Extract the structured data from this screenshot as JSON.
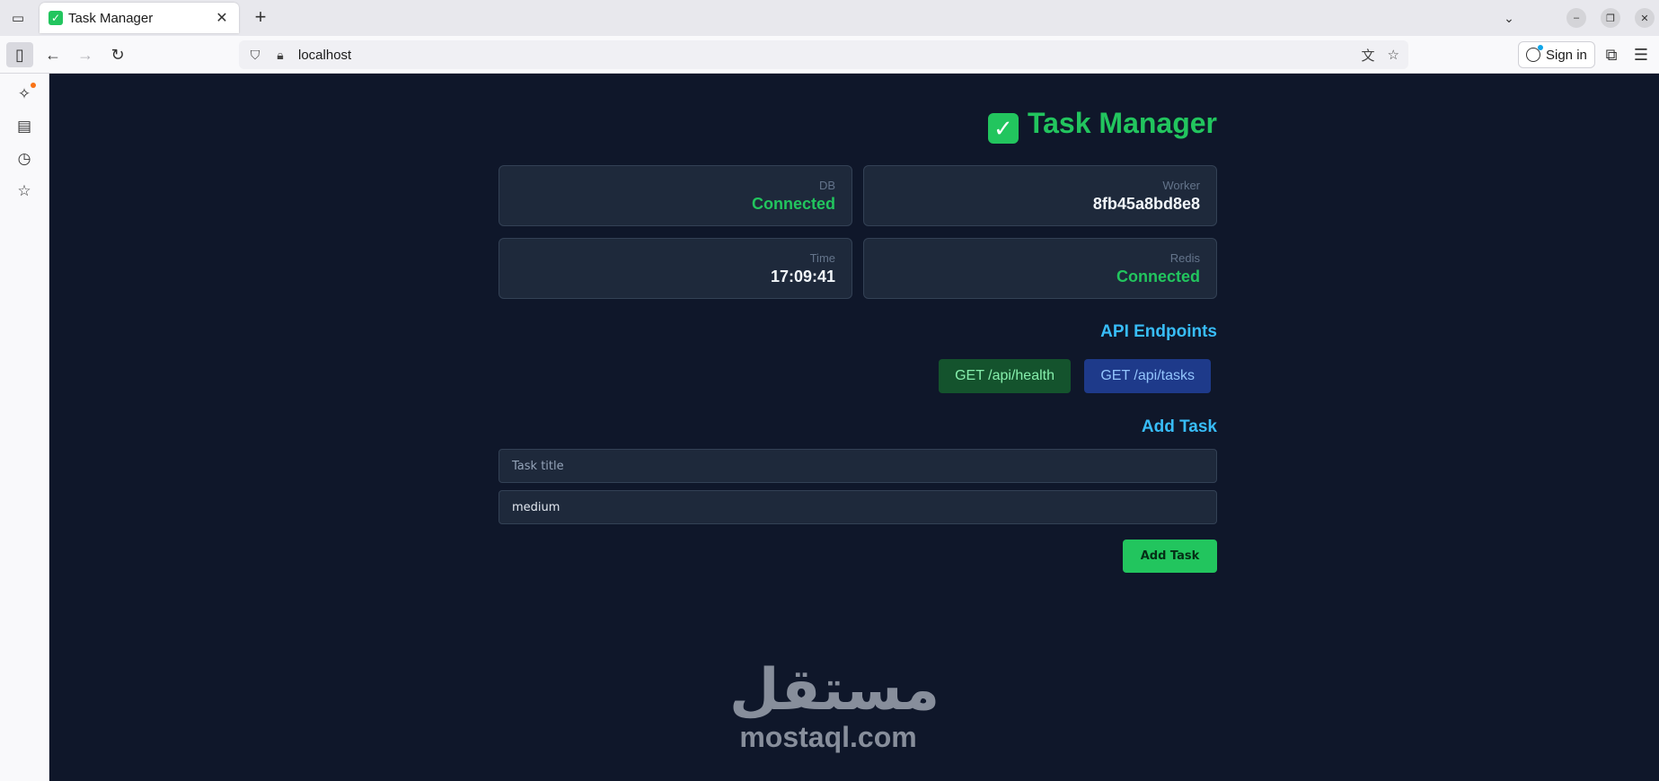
{
  "browser": {
    "tab_title": "Task Manager",
    "tab_favicon": "✓",
    "url": "localhost",
    "sign_in_label": "Sign in"
  },
  "app": {
    "title": "Task Manager",
    "title_icon": "✓",
    "status_cards": [
      {
        "label": "DB",
        "value": "Connected",
        "tone": "green"
      },
      {
        "label": "Worker",
        "value": "8fb45a8bd8e8",
        "tone": "white"
      },
      {
        "label": "Time",
        "value": "17:09:41",
        "tone": "white"
      },
      {
        "label": "Redis",
        "value": "Connected",
        "tone": "green"
      }
    ],
    "api_section_title": "API Endpoints",
    "api_buttons": [
      "GET /api/health",
      "GET /api/tasks"
    ],
    "add_section_title": "Add Task",
    "task_title_placeholder": "Task title",
    "priority_value": "medium",
    "add_button_label": "Add Task"
  },
  "watermark": {
    "arabic": "مستقل",
    "latin": "mostaql.com"
  },
  "colors": {
    "accent_green": "#22c55e",
    "accent_blue": "#38bdf8",
    "page_bg": "#0f172a",
    "card_bg": "#1e293b"
  }
}
